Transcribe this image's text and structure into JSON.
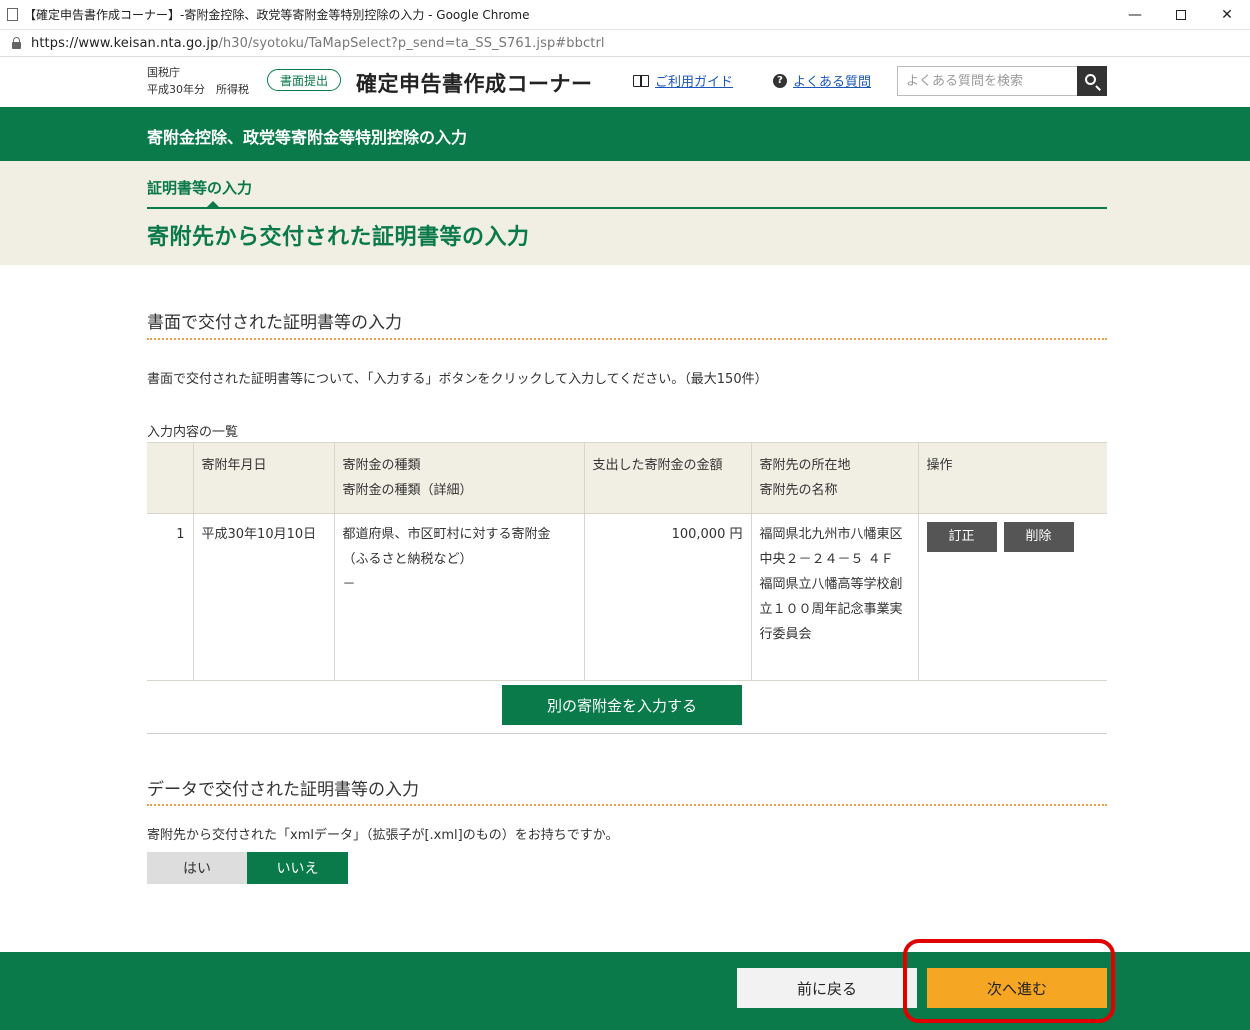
{
  "browser": {
    "window_title": "【確定申告書作成コーナー】-寄附金控除、政党等寄附金等特別控除の入力 - Google Chrome",
    "url_host": "https://www.keisan.nta.go.jp",
    "url_rest": "/h30/syotoku/TaMapSelect?p_send=ta_SS_S761.jsp#bbctrl",
    "minimize": "—",
    "close": "✕"
  },
  "header": {
    "agency": "国税庁",
    "year_tax": "平成30年分　所得税",
    "submit_badge": "書面提出",
    "corner_title": "確定申告書作成コーナー",
    "guide_link": "ご利用ガイド",
    "faq_link": "よくある質問",
    "faq_icon_glyph": "?",
    "search_placeholder": "よくある質問を検索"
  },
  "banner": {
    "title": "寄附金控除、政党等寄附金等特別控除の入力"
  },
  "step": {
    "label": "証明書等の入力",
    "page_title": "寄附先から交付された証明書等の入力"
  },
  "paper_section": {
    "title": "書面で交付された証明書等の入力",
    "instruction": "書面で交付された証明書等について、「入力する」ボタンをクリックして入力してください。（最大150件）",
    "list_caption": "入力内容の一覧",
    "columns": {
      "no": "",
      "date": "寄附年月日",
      "type": "寄附金の種類",
      "type_detail": "寄附金の種類（詳細）",
      "amount": "支出した寄附金の金額",
      "address": "寄附先の所在地",
      "name": "寄附先の名称",
      "operation": "操作"
    },
    "rows": [
      {
        "no": "1",
        "date": "平成30年10月10日",
        "type": "都道府県、市区町村に対する寄附金（ふるさと納税など）",
        "type_detail": "－",
        "amount": "100,000 円",
        "address": "福岡県北九州市八幡東区中央２－２４－５ ４Ｆ",
        "name": "福岡県立八幡高等学校創立１００周年記念事業実行委員会",
        "edit_label": "訂正",
        "delete_label": "削除"
      }
    ],
    "add_button": "別の寄附金を入力する"
  },
  "data_section": {
    "title": "データで交付された証明書等の入力",
    "question": "寄附先から交付された「xmlデータ」（拡張子が[.xml]のもの）をお持ちですか。",
    "yes_label": "はい",
    "no_label": "いいえ",
    "selected": "いいえ"
  },
  "footer": {
    "back_label": "前に戻る",
    "next_label": "次へ進む"
  },
  "colors": {
    "brand_green": "#0a7a4a",
    "next_orange": "#f5a623",
    "highlight_red": "#e00000"
  }
}
